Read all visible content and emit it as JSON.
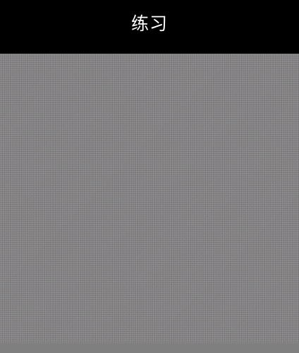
{
  "header": {
    "title": "练习"
  }
}
